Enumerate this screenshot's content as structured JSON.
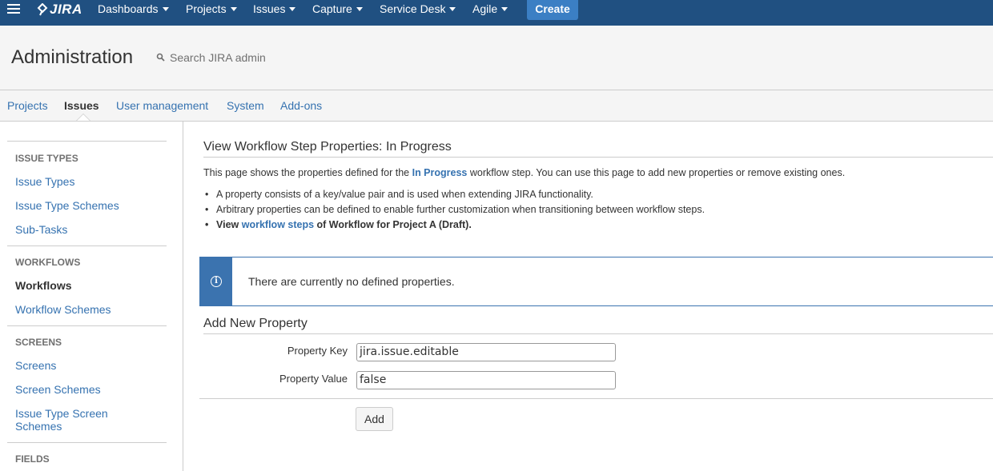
{
  "nav": {
    "logo": "JIRA",
    "items": [
      {
        "label": "Dashboards"
      },
      {
        "label": "Projects"
      },
      {
        "label": "Issues"
      },
      {
        "label": "Capture"
      },
      {
        "label": "Service Desk"
      },
      {
        "label": "Agile"
      }
    ],
    "create_label": "Create"
  },
  "admin": {
    "title": "Administration",
    "search_placeholder": "Search JIRA admin"
  },
  "tabs": [
    {
      "label": "Projects"
    },
    {
      "label": "Issues",
      "active": true
    },
    {
      "label": "User management"
    },
    {
      "label": "System"
    },
    {
      "label": "Add-ons"
    }
  ],
  "sidebar": {
    "sections": [
      {
        "heading": "ISSUE TYPES",
        "items": [
          "Issue Types",
          "Issue Type Schemes",
          "Sub-Tasks"
        ]
      },
      {
        "heading": "WORKFLOWS",
        "items": [
          "Workflows",
          "Workflow Schemes"
        ]
      },
      {
        "heading": "SCREENS",
        "items": [
          "Screens",
          "Screen Schemes",
          "Issue Type Screen Schemes"
        ]
      },
      {
        "heading": "FIELDS",
        "items": []
      }
    ],
    "active_item": "Workflows"
  },
  "main": {
    "title": "View Workflow Step Properties: In Progress",
    "desc_prefix": "This page shows the properties defined for the",
    "desc_step": "In Progress",
    "desc_suffix": "workflow step. You can use this page to add new properties or remove existing ones.",
    "bullets": [
      "A property consists of a key/value pair and is used when extending JIRA functionality.",
      "Arbitrary properties can be defined to enable further customization when transitioning between workflow steps."
    ],
    "view_prefix": "View",
    "view_link": "workflow steps",
    "view_suffix": "of Workflow for Project A (Draft).",
    "info_message": "There are currently no defined properties.",
    "add_title": "Add New Property",
    "key_label": "Property Key",
    "key_value": "jira.issue.editable",
    "value_label": "Property Value",
    "value_value": "false",
    "add_button": "Add"
  }
}
